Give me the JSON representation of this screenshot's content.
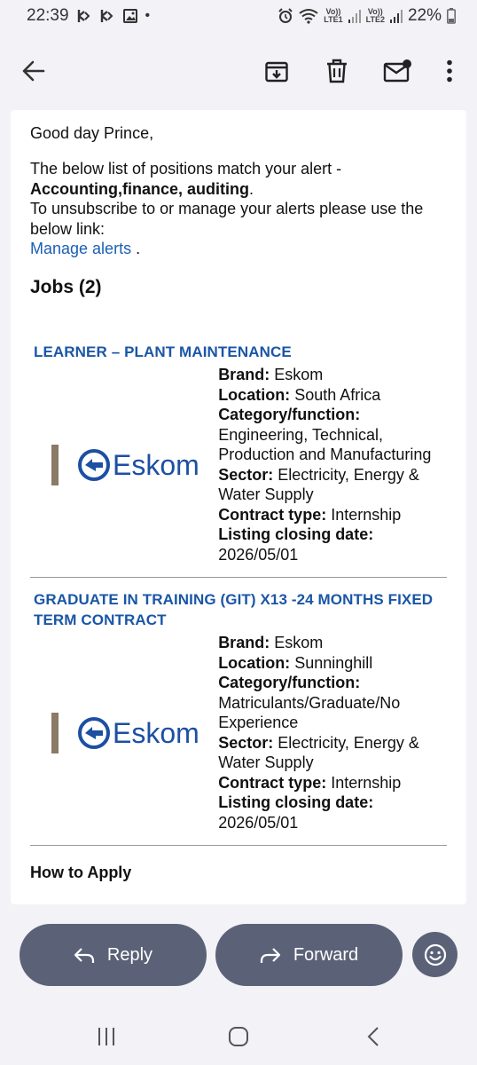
{
  "status_bar": {
    "time": "22:39",
    "dot": "•",
    "sim1_label_top": "Vo))",
    "sim1_label_bottom": "LTE1",
    "sim2_label_top": "Vo))",
    "sim2_label_bottom": "LTE2",
    "battery": "22%"
  },
  "toolbar": {
    "icons": [
      "back-arrow-icon",
      "archive-icon",
      "delete-icon",
      "mark-unread-icon",
      "more-vert-icon"
    ]
  },
  "email": {
    "greeting": "Good day Prince,",
    "intro_line": "The below list of positions match your alert -",
    "alert_name": "Accounting,finance, auditing",
    "alert_end": ".",
    "unsubscribe_text": "To unsubscribe to or manage your alerts please use the below link:",
    "manage_link": "Manage alerts",
    "manage_after": " .",
    "jobs_heading": "Jobs (2)",
    "jobs": [
      {
        "title": "LEARNER – PLANT MAINTENANCE",
        "logo_text": "Eskom",
        "brand_label": "Brand:",
        "brand": "Eskom",
        "location_label": "Location:",
        "location": "South Africa",
        "category_label": "Category/function:",
        "category": "Engineering, Technical, Production and Manufacturing",
        "sector_label": "Sector:",
        "sector": "Electricity, Energy & Water Supply",
        "contract_label": "Contract type:",
        "contract": "Internship",
        "closing_label": "Listing closing date:",
        "closing": "2026/05/01"
      },
      {
        "title": "GRADUATE IN TRAINING (GIT) X13 -24 MONTHS FIXED TERM CONTRACT",
        "logo_text": "Eskom",
        "brand_label": "Brand:",
        "brand": "Eskom",
        "location_label": "Location:",
        "location": "Sunninghill",
        "category_label": "Category/function:",
        "category": "Matriculants/Graduate/No Experience",
        "sector_label": "Sector:",
        "sector": "Electricity, Energy & Water Supply",
        "contract_label": "Contract type:",
        "contract": "Internship",
        "closing_label": "Listing closing date:",
        "closing": "2026/05/01"
      }
    ],
    "how_to_apply": "How to Apply"
  },
  "actions": {
    "reply_label": "Reply",
    "forward_label": "Forward"
  },
  "colors": {
    "link": "#1a5fb4",
    "job_title": "#1a56a6",
    "eskom_blue": "#1d4fa3",
    "eskom_bracket": "#8b7a64",
    "action_bg": "#5b6278"
  }
}
